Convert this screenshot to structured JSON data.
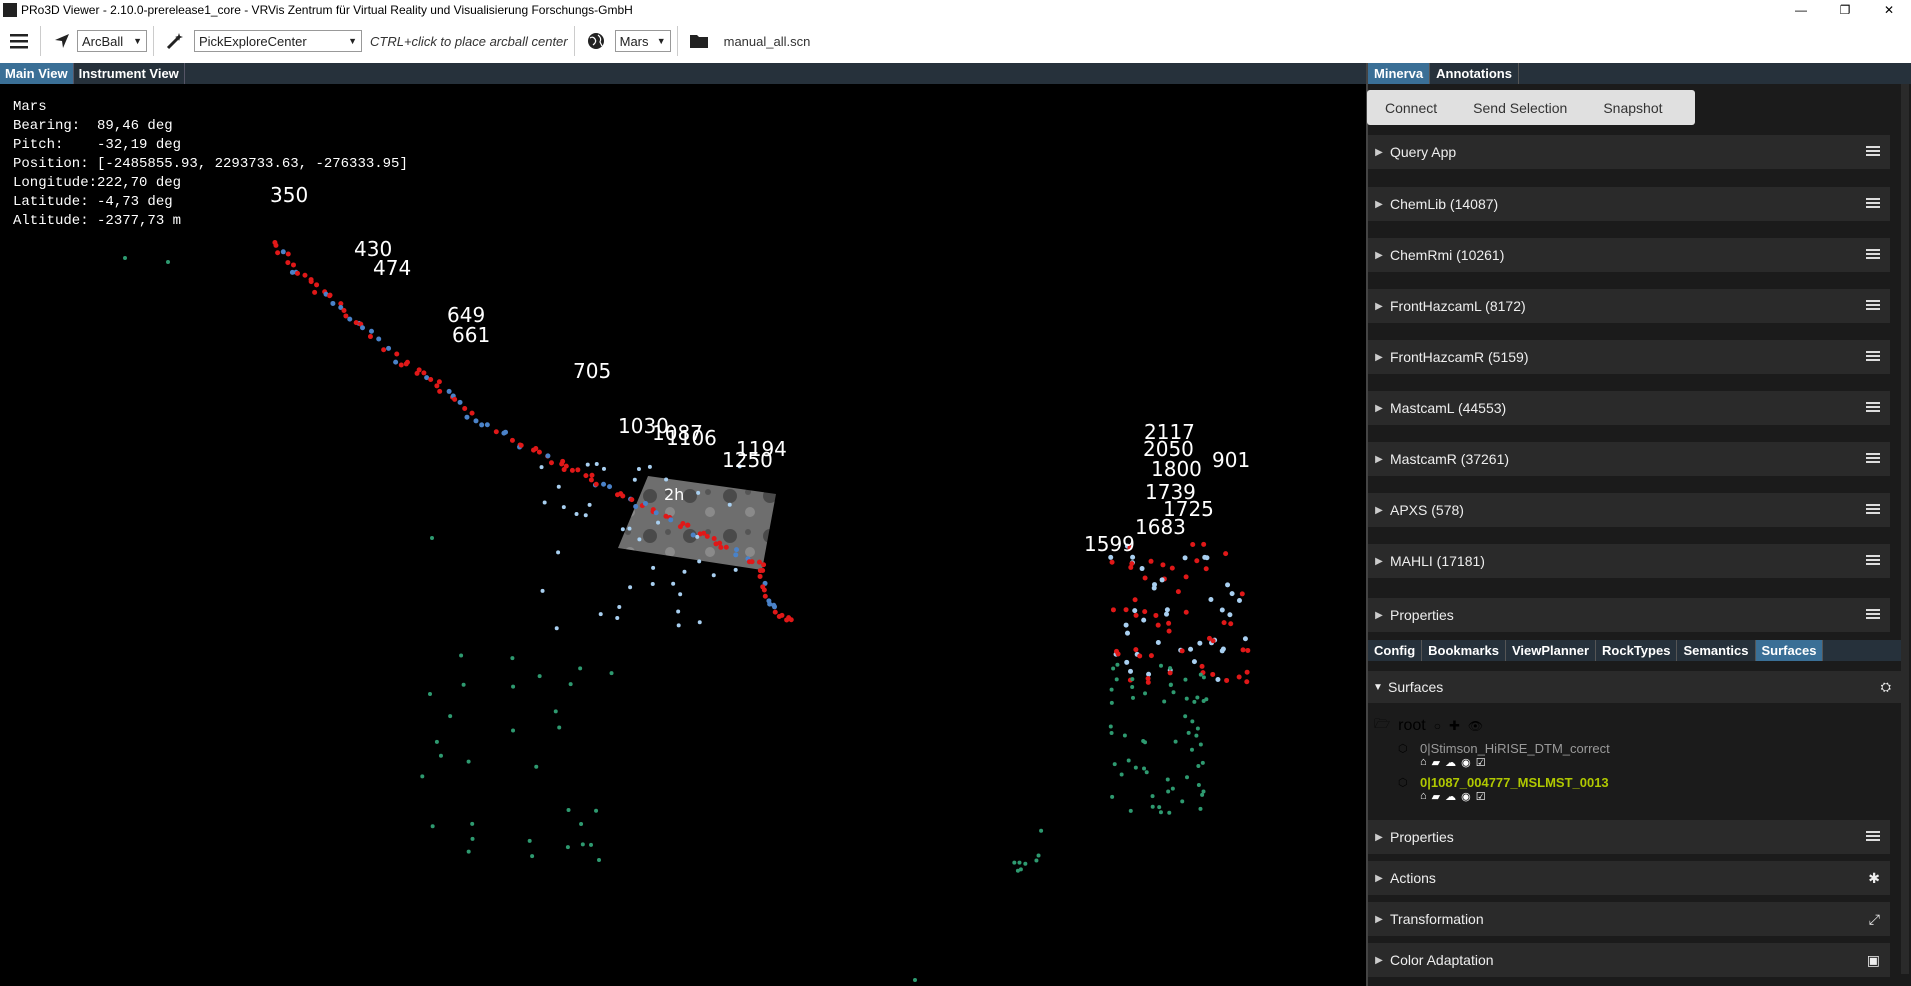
{
  "window": {
    "title": "PRo3D Viewer - 2.10.0-prerelease1_core - VRVis Zentrum für Virtual Reality und Visualisierung Forschungs-GmbH",
    "controls": [
      "—",
      "❐",
      "✕"
    ]
  },
  "toolbar": {
    "camera_mode": "ArcBall",
    "pick_mode": "PickExploreCenter",
    "hint": "CTRL+click to place arcball center",
    "planet": "Mars",
    "scene_file": "manual_all.scn"
  },
  "view_tabs": [
    "Main View",
    "Instrument View"
  ],
  "hud": {
    "planet": "Mars",
    "bearing": "Bearing:  89,46 deg",
    "pitch": "Pitch:    -32,19 deg",
    "position": "Position: [-2485855.93, 2293733.63, -276333.95]",
    "longitude": "Longitude:222,70 deg",
    "latitude": "Latitude: -4,73 deg",
    "altitude": "Altitude: -2377,73 m"
  },
  "scene_labels": [
    "350",
    "430",
    "474",
    "649",
    "661",
    "705",
    "1030",
    "1087",
    "1106",
    "1194",
    "1250",
    "2050",
    "1800",
    "1739",
    "1725",
    "1683",
    "1599",
    "901",
    "2117",
    "2h"
  ],
  "colors": {
    "red": "#e01818",
    "blue": "#4a82c8",
    "lightblue": "#a8cff0",
    "green": "#2e9a70",
    "accent": "#3a6f96"
  },
  "right_panel": {
    "top_tabs": [
      "Minerva",
      "Annotations"
    ],
    "minerva_buttons": [
      "Connect",
      "Send Selection",
      "Snapshot"
    ],
    "sections": [
      "Query App",
      "ChemLib (14087)",
      "ChemRmi (10261)",
      "FrontHazcamL (8172)",
      "FrontHazcamR (5159)",
      "MastcamL (44553)",
      "MastcamR (37261)",
      "APXS (578)",
      "MAHLI (17181)",
      "Properties"
    ],
    "bottom_tabs": [
      "Config",
      "Bookmarks",
      "ViewPlanner",
      "RockTypes",
      "Semantics",
      "Surfaces"
    ],
    "surfaces_title": "Surfaces",
    "tree_root": "root",
    "surfaces": [
      {
        "name": "0|Stimson_HiRISE_DTM_correct",
        "color": "#9a9a9a"
      },
      {
        "name": "0|1087_004777_MSLMST_0013",
        "color": "#b0c800"
      }
    ],
    "lower_sections": [
      "Properties",
      "Actions",
      "Transformation",
      "Color Adaptation"
    ]
  }
}
